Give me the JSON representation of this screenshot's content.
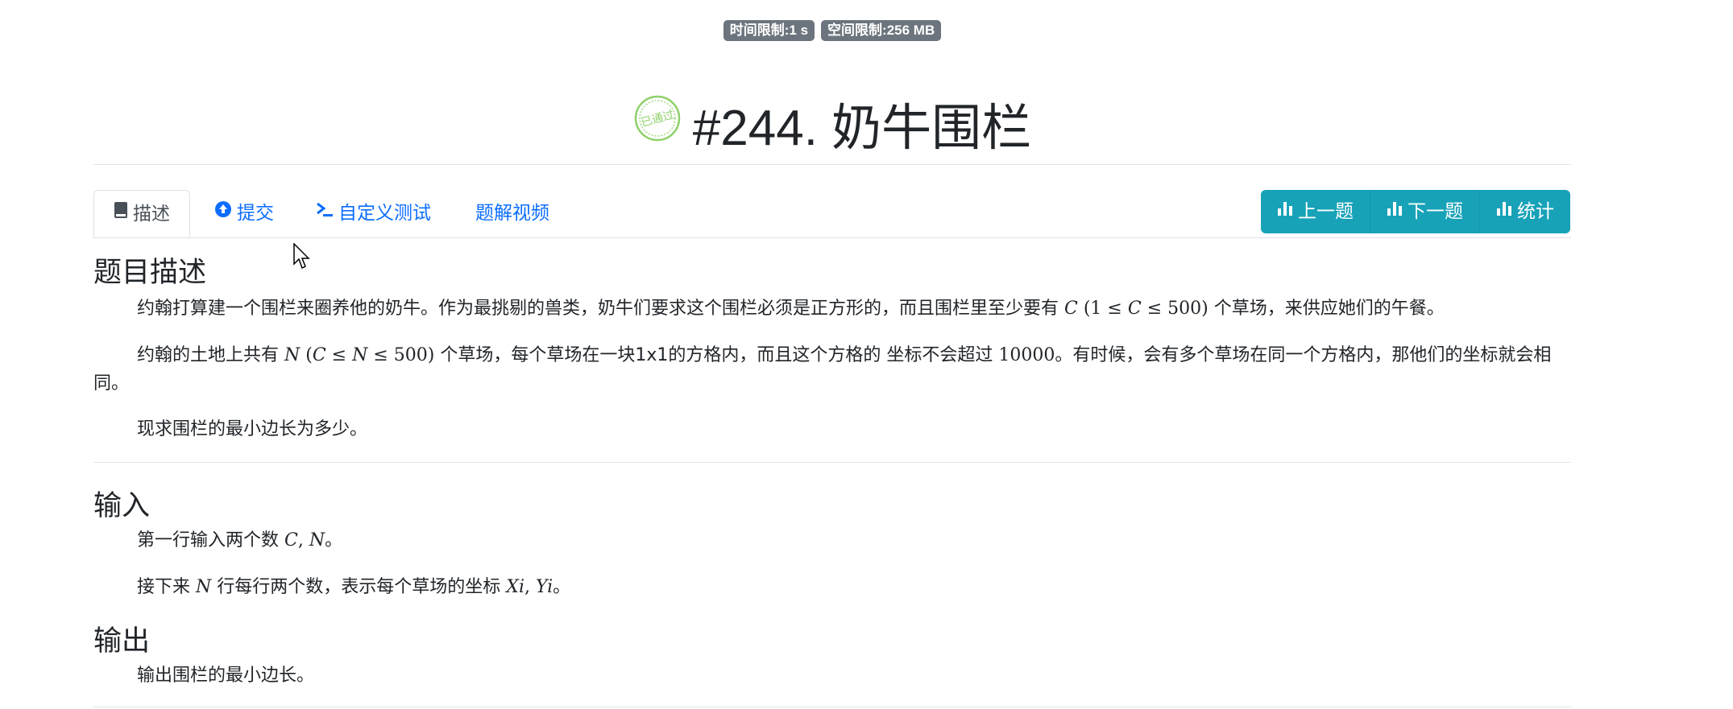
{
  "limits": {
    "time": "时间限制:1 s",
    "space": "空间限制:256 MB"
  },
  "problem": {
    "stamp_text": "已通过",
    "title": "#244. 奶牛围栏"
  },
  "tabs": [
    {
      "label": "描述",
      "icon": "book-icon",
      "active": true
    },
    {
      "label": "提交",
      "icon": "upload-circle-icon",
      "active": false
    },
    {
      "label": "自定义测试",
      "icon": "terminal-icon",
      "active": false
    },
    {
      "label": "题解视频",
      "icon": "",
      "active": false
    }
  ],
  "nav_buttons": [
    {
      "label": "上一题",
      "icon": "bar-chart-icon"
    },
    {
      "label": "下一题",
      "icon": "bar-chart-icon"
    },
    {
      "label": "统计",
      "icon": "bar-chart-icon"
    }
  ],
  "sections": {
    "description": {
      "title": "题目描述",
      "p1_a": "约翰打算建一个围栏来圈养他的奶牛。作为最挑剔的兽类，奶牛们要求这个围栏必须是正方形的，而且围栏里至少要有",
      "p1_b": "个草场，来供应她们的午餐。",
      "p2_a": "约翰的土地上共有",
      "p2_b": "个草场，每个草场在一块1x1的方格内，而且这个方格的 坐标不会超过",
      "p2_num": "10000",
      "p2_c": "。有时候，会有多个草场在同一个方格内，那他们的坐标就会相同。",
      "p3": "现求围栏的最小边长为多少。"
    },
    "input": {
      "title": "输入",
      "p1_a": "第一行输入两个数",
      "p1_b": "。",
      "p2_a": "接下来",
      "p2_b": "行每行两个数，表示每个草场的坐标",
      "p2_c": "。"
    },
    "output": {
      "title": "输出",
      "p1": "输出围栏的最小边长。"
    }
  },
  "colors": {
    "accent_teal": "#17a2b8",
    "link_blue": "#0d6efd",
    "badge_gray": "#6c757d",
    "stamp_green": "#7cc47f"
  }
}
